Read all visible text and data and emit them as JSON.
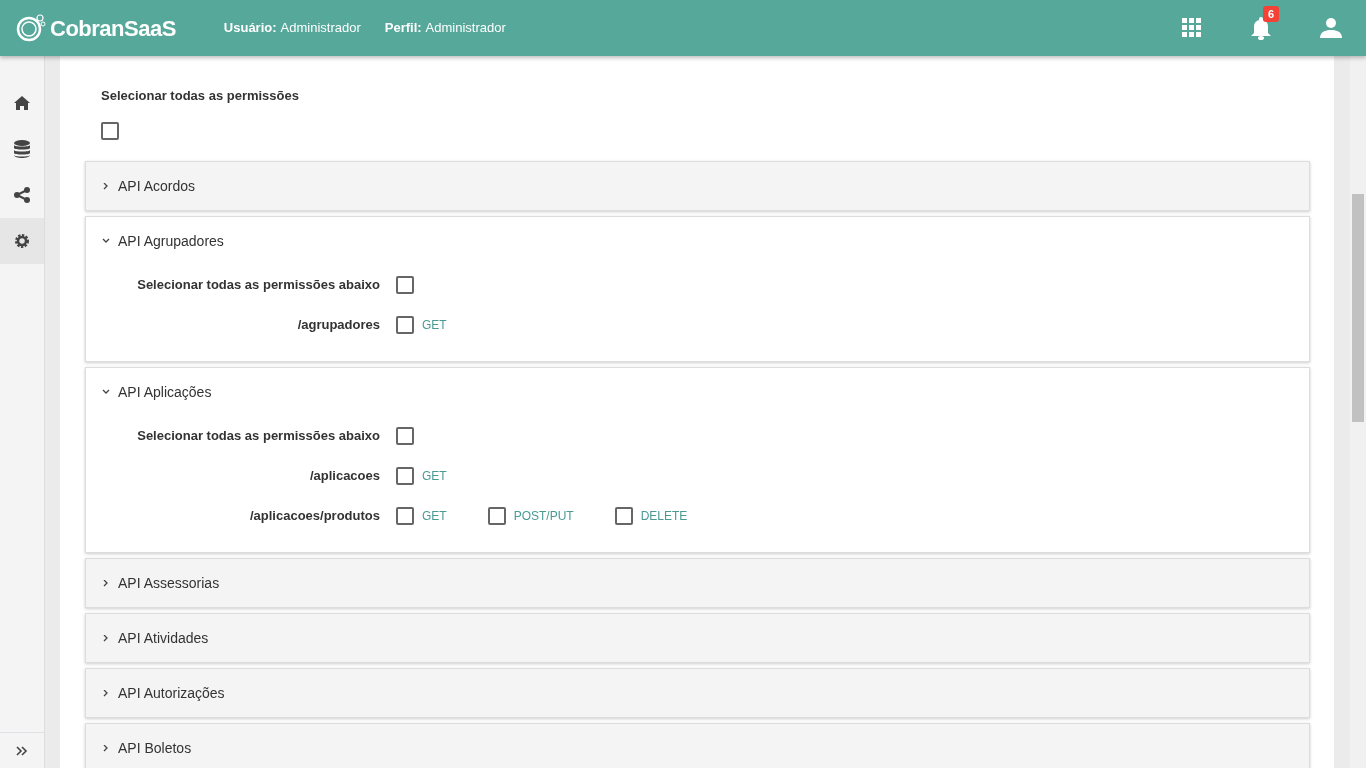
{
  "header": {
    "brand": "CobranSaaS",
    "user_label": "Usuário:",
    "user_value": "Administrador",
    "profile_label": "Perfil:",
    "profile_value": "Administrador",
    "notification_count": "6"
  },
  "sidebar": {
    "items": [
      {
        "kind": "home",
        "selected": false
      },
      {
        "kind": "database",
        "selected": false
      },
      {
        "kind": "share",
        "selected": false
      },
      {
        "kind": "settings",
        "selected": true
      }
    ]
  },
  "select_all": {
    "label": "Selecionar todas as permissões",
    "checked": false
  },
  "panels": [
    {
      "title": "API Acordos",
      "expanded": false
    },
    {
      "title": "API Agrupadores",
      "expanded": true,
      "select_all_label": "Selecionar todas as permissões abaixo",
      "select_all_checked": false,
      "routes": [
        {
          "path": "/agrupadores",
          "methods": [
            {
              "label": "GET",
              "checked": false
            }
          ]
        }
      ]
    },
    {
      "title": "API Aplicações",
      "expanded": true,
      "select_all_label": "Selecionar todas as permissões abaixo",
      "select_all_checked": false,
      "routes": [
        {
          "path": "/aplicacoes",
          "methods": [
            {
              "label": "GET",
              "checked": false
            }
          ]
        },
        {
          "path": "/aplicacoes/produtos",
          "methods": [
            {
              "label": "GET",
              "checked": false
            },
            {
              "label": "POST/PUT",
              "checked": false
            },
            {
              "label": "DELETE",
              "checked": false
            }
          ]
        }
      ]
    },
    {
      "title": "API Assessorias",
      "expanded": false
    },
    {
      "title": "API Atividades",
      "expanded": false
    },
    {
      "title": "API Autorizações",
      "expanded": false
    },
    {
      "title": "API Boletos",
      "expanded": false
    }
  ]
}
